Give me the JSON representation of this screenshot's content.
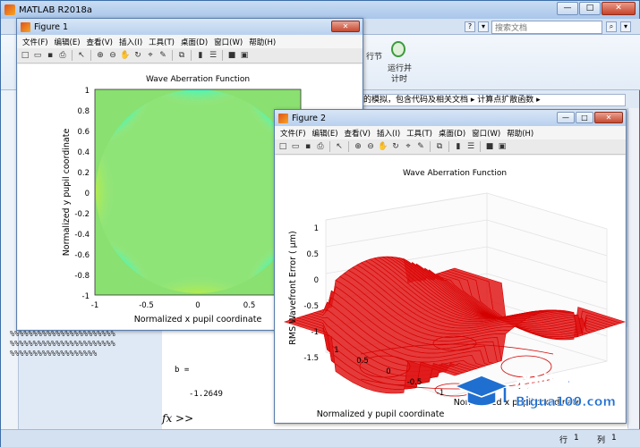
{
  "app": {
    "title": "MATLAB R2018a",
    "search_placeholder": "搜索文档",
    "ribbon": {
      "line1": "行节",
      "run_advance_1": "运行并",
      "run_advance_2": "计时"
    },
    "path_text": "的模拟，包含代码及相关文档 ▸ 计算点扩散函数 ▸",
    "console": {
      "var_line": "b =",
      "value_line": "-1.2649",
      "prompt": "fx >>"
    },
    "workspace_lines": [
      "%%%%%%%%%%%%%%%%%%%%%%%",
      "%%%%%%%%%%%%%%%%%%%%%%%",
      "%%%%%%%%%%%%%%%%%%%"
    ],
    "status": {
      "row_label": "行",
      "row_value": "1",
      "col_label": "列",
      "col_value": "1"
    }
  },
  "menu_items": [
    "文件(F)",
    "编辑(E)",
    "查看(V)",
    "插入(I)",
    "工具(T)",
    "桌面(D)",
    "窗口(W)",
    "帮助(H)"
  ],
  "figure1": {
    "title": "Figure 1",
    "plot_title": "Wave Aberration Function",
    "xlabel": "Normalized x pupil coordinate",
    "ylabel": "Normalized y pupil coordinate",
    "xticks": [
      "-1",
      "-0.5",
      "0",
      "0.5",
      "1"
    ],
    "yticks": [
      "1",
      "0.8",
      "0.6",
      "0.4",
      "0.2",
      "0",
      "-0.2",
      "-0.4",
      "-0.6",
      "-0.8",
      "-1"
    ]
  },
  "figure2": {
    "title": "Figure 2",
    "plot_title": "Wave Aberration Function",
    "zlabel": "RMS Wavefront Error ( μm)",
    "ylabel": "Normalized y pupil coordinate",
    "xlabel": "Normalized x pupil coordinate",
    "zticks": [
      "1",
      "0.5",
      "0",
      "-0.5",
      "-1",
      "-1.5"
    ],
    "yticks": [
      "1",
      "0.5",
      "0",
      "-0.5",
      "-1"
    ],
    "xticks": [
      "-0.5",
      "0"
    ]
  },
  "watermark": {
    "brand": "必过源码",
    "url": "Bigua100.com"
  },
  "colors": {
    "surface": "#d40000",
    "grid": "#e6e6e6",
    "accent": "#3c6ea8"
  }
}
